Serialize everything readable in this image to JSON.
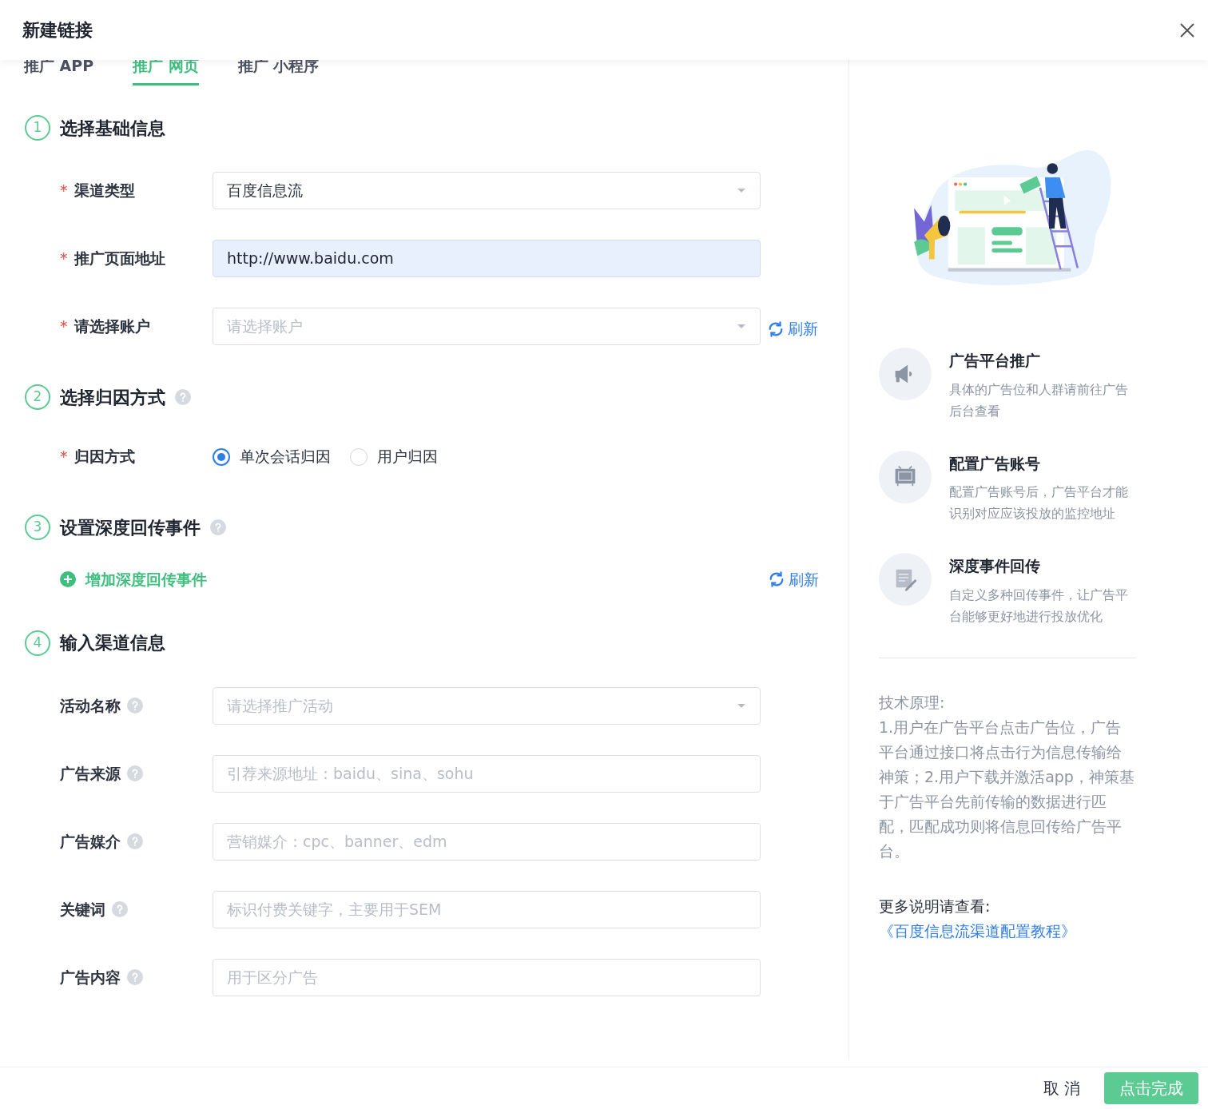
{
  "dialog": {
    "title": "新建链接"
  },
  "tabs": [
    {
      "label": "推广 APP",
      "selected": false
    },
    {
      "label": "推广 网页",
      "selected": true
    },
    {
      "label": "推广 小程序",
      "selected": false
    }
  ],
  "sections": [
    {
      "number": "1",
      "title": "选择基础信息",
      "fields": [
        {
          "kind": "select",
          "label": "渠道类型",
          "required_mark": "*",
          "value": "百度信息流"
        },
        {
          "kind": "input",
          "label": "推广页面地址",
          "required_mark": "*",
          "value": "http://www.baidu.com",
          "highlighted": true
        },
        {
          "kind": "select",
          "label": "请选择账户",
          "required_mark": "*",
          "placeholder": "请选择账户",
          "refresh": "刷新"
        }
      ]
    },
    {
      "number": "2",
      "title": "选择归因方式",
      "help": true,
      "fields": [
        {
          "kind": "radio",
          "label": "归因方式",
          "required_mark": "*",
          "options": [
            {
              "label": "单次会话归因",
              "selected": true
            },
            {
              "label": "用户归因",
              "selected": false
            }
          ]
        }
      ]
    },
    {
      "number": "3",
      "title": "设置深度回传事件",
      "help": true,
      "fields": [
        {
          "kind": "add",
          "label": "增加深度回传事件",
          "refresh": "刷新"
        }
      ]
    },
    {
      "number": "4",
      "title": "输入渠道信息",
      "fields": [
        {
          "kind": "select",
          "label": "活动名称",
          "help": true,
          "placeholder": "请选择推广活动"
        },
        {
          "kind": "input",
          "label": "广告来源",
          "help": true,
          "placeholder": "引荐来源地址：baidu、sina、sohu"
        },
        {
          "kind": "input",
          "label": "广告媒介",
          "help": true,
          "placeholder": "营销媒介：cpc、banner、edm"
        },
        {
          "kind": "input",
          "label": "关键词",
          "help": true,
          "placeholder": "标识付费关键字，主要用于SEM"
        },
        {
          "kind": "input",
          "label": "广告内容",
          "help": true,
          "placeholder": "用于区分广告"
        }
      ]
    }
  ],
  "side": {
    "features": [
      {
        "kind": "megaphone",
        "title": "广告平台推广",
        "text": "具体的广告位和人群请前往广告后台查看"
      },
      {
        "kind": "ad",
        "title": "配置广告账号",
        "text": "配置广告账号后，广告平台才能识别对应应该投放的监控地址"
      },
      {
        "kind": "note",
        "title": "深度事件回传",
        "text": "自定义多种回传事件，让广告平台能够更好地进行投放优化"
      }
    ],
    "principle_title": "技术原理:",
    "principle_text": "1.用户在广告平台点击广告位，广告平台通过接口将点击行为信息传输给神策；2.用户下载并激活app，神策基于广告平台先前传输的数据进行匹配，匹配成功则将信息回传给广告平台。",
    "more_label": "更多说明请查看:",
    "more_link": "《百度信息流渠道配置教程》"
  },
  "footer": {
    "buttons": [
      {
        "kind": "secondary",
        "label": "取 消"
      },
      {
        "kind": "primary",
        "label": "点击完成"
      }
    ]
  }
}
